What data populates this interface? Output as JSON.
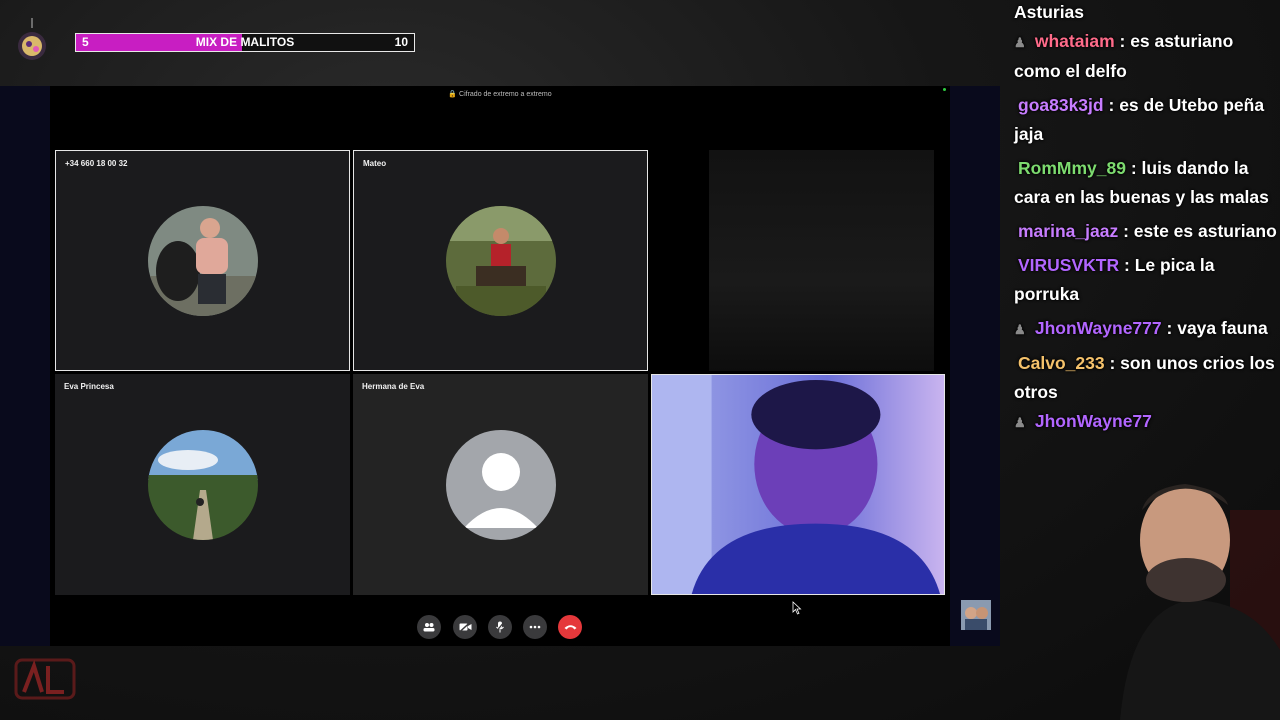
{
  "overlay": {
    "goal": {
      "start": "5",
      "title": "MIX DE MALITOS",
      "end": "10",
      "progress": 0.49,
      "fill_color": "#c81ec2"
    }
  },
  "call": {
    "encryption_notice": "Cifrado de extremo a extremo",
    "tiles": [
      {
        "name": "+34 660 18 00 32"
      },
      {
        "name": "Mateo"
      },
      {
        "name": "Eva Princesa"
      },
      {
        "name": "Hermana de Eva"
      }
    ],
    "controls": {
      "participants_icon": "people-icon",
      "video_icon": "video-off-icon",
      "mic_icon": "mic-off-icon",
      "more_icon": "more-icon",
      "end_icon": "end-call-icon"
    },
    "end_call_color": "#e5383b"
  },
  "chat": {
    "messages": [
      {
        "user": "",
        "text": "Asturias",
        "color": "#ffffff",
        "badge": false
      },
      {
        "user": "whataiam",
        "text": "es asturiano como el delfo",
        "color": "#ff6b8a",
        "badge": true
      },
      {
        "user": "goa83k3jd",
        "text": "es de Utebo peña jaja",
        "color": "#c77dff",
        "badge": false
      },
      {
        "user": "RomMmy_89",
        "text": "luis dando la cara en las buenas y las malas",
        "color": "#7ddb6f",
        "badge": false
      },
      {
        "user": "marina_jaaz",
        "text": "este es asturiano",
        "color": "#c77dff",
        "badge": false
      },
      {
        "user": "VIRUSVKTR",
        "text": "Le pica la porruka",
        "color": "#b266ff",
        "badge": false
      },
      {
        "user": "JhonWayne777",
        "text": "vaya fauna",
        "color": "#b266ff",
        "badge": true
      },
      {
        "user": "Calvo_233",
        "text": "son unos crios los otros",
        "color": "#f5c26b",
        "badge": false
      },
      {
        "user": "JhonWayne77",
        "text": "",
        "color": "#b266ff",
        "badge": true
      }
    ]
  }
}
